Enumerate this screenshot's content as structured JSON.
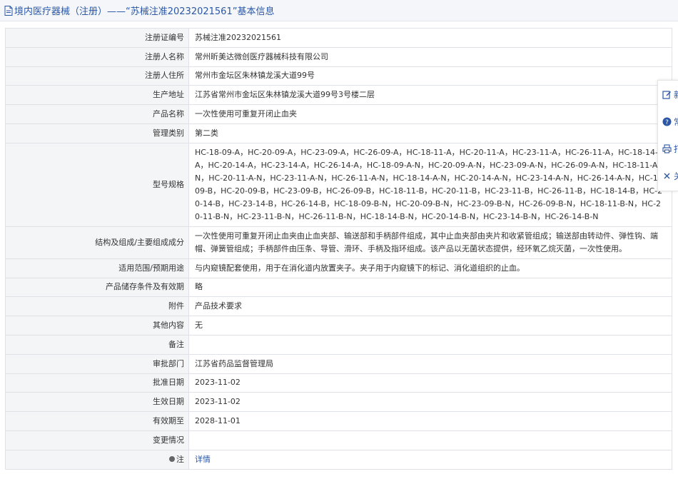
{
  "header": {
    "title": "境内医疗器械（注册）——“苏械注准20232021561”基本信息"
  },
  "rows": [
    {
      "label": "注册证编号",
      "value": "苏械注准20232021561"
    },
    {
      "label": "注册人名称",
      "value": "常州昕美达微创医疗器械科技有限公司"
    },
    {
      "label": "注册人住所",
      "value": "常州市金坛区朱林镇龙溪大道99号"
    },
    {
      "label": "生产地址",
      "value": "江苏省常州市金坛区朱林镇龙溪大道99号3号楼二层"
    },
    {
      "label": "产品名称",
      "value": "一次性使用可重复开闭止血夹"
    },
    {
      "label": "管理类别",
      "value": "第二类"
    },
    {
      "label": "型号规格",
      "value": "HC-18-09-A，HC-20-09-A，HC-23-09-A，HC-26-09-A，HC-18-11-A，HC-20-11-A，HC-23-11-A，HC-26-11-A，HC-18-14-A，HC-20-14-A，HC-23-14-A，HC-26-14-A，HC-18-09-A-N，HC-20-09-A-N，HC-23-09-A-N，HC-26-09-A-N，HC-18-11-A-N，HC-20-11-A-N，HC-23-11-A-N，HC-26-11-A-N，HC-18-14-A-N，HC-20-14-A-N，HC-23-14-A-N，HC-26-14-A-N，HC-18-09-B，HC-20-09-B，HC-23-09-B，HC-26-09-B，HC-18-11-B，HC-20-11-B，HC-23-11-B，HC-26-11-B，HC-18-14-B，HC-20-14-B，HC-23-14-B，HC-26-14-B，HC-18-09-B-N，HC-20-09-B-N，HC-23-09-B-N，HC-26-09-B-N，HC-18-11-B-N，HC-20-11-B-N，HC-23-11-B-N，HC-26-11-B-N，HC-18-14-B-N，HC-20-14-B-N，HC-23-14-B-N，HC-26-14-B-N"
    },
    {
      "label": "结构及组成/主要组成成分",
      "value": "一次性使用可重复开闭止血夹由止血夹部、输送部和手柄部件组成，其中止血夹部由夹片和收紧管组成；输送部由转动件、弹性钩、端帽、弹簧管组成；手柄部件由压条、导管、滑环、手柄及指环组成。该产品以无菌状态提供，经环氧乙烷灭菌，一次性使用。"
    },
    {
      "label": "适用范围/预期用途",
      "value": "与内窥镜配套使用，用于在消化道内放置夹子。夹子用于内窥镜下的标记、消化道组织的止血。"
    },
    {
      "label": "产品储存条件及有效期",
      "value": "略"
    },
    {
      "label": "附件",
      "value": "产品技术要求"
    },
    {
      "label": "其他内容",
      "value": "无"
    },
    {
      "label": "备注",
      "value": ""
    },
    {
      "label": "审批部门",
      "value": "江苏省药品监督管理局"
    },
    {
      "label": "批准日期",
      "value": "2023-11-02"
    },
    {
      "label": "生效日期",
      "value": "2023-11-02"
    },
    {
      "label": "有效期至",
      "value": "2028-11-01"
    },
    {
      "label": "变更情况",
      "value": ""
    },
    {
      "label": "注",
      "value": "详情"
    }
  ],
  "side_tools": [
    {
      "label": "新",
      "icon": "edit-icon"
    },
    {
      "label": "常",
      "icon": "help-icon"
    },
    {
      "label": "打",
      "icon": "print-icon"
    },
    {
      "label": "关",
      "icon": "close-icon"
    }
  ]
}
